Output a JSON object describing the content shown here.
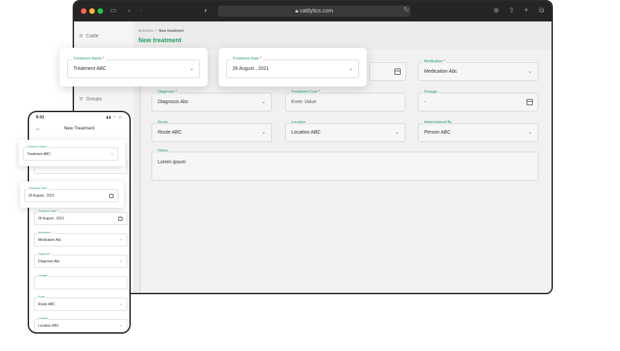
{
  "browser": {
    "url": "cattlytics.com",
    "sidebar": [
      {
        "label": "Cattle",
        "icon": "cattle-icon"
      },
      {
        "label": "Groups",
        "icon": "groups-icon"
      }
    ],
    "breadcrumb": {
      "parent": "Activities",
      "separator": "/",
      "current": "New treatment"
    },
    "title": "New treatment",
    "fields": {
      "medication": {
        "label": "Medication",
        "required": "*",
        "value": "Medication Abc"
      },
      "diagnosis": {
        "label": "Diagnosis",
        "required": "*",
        "value": "Diagnosis Abc"
      },
      "cost": {
        "label": "Treatment Cost",
        "required": "*",
        "value": "Enter Value"
      },
      "dosage": {
        "label": "Dosage",
        "value": "-"
      },
      "route": {
        "label": "Route",
        "value": "Route ABC"
      },
      "location": {
        "label": "Location",
        "value": "Location ABC"
      },
      "administered": {
        "label": "Administered By",
        "value": "Person ABC"
      },
      "notes": {
        "label": "Notes",
        "value": "Lorem ipsum"
      }
    }
  },
  "floating": {
    "treatment_name": {
      "label": "Treatment Name",
      "required": "*",
      "value": "Treatment ABC"
    },
    "treatment_date": {
      "label": "Treatment Date",
      "required": "*",
      "value": "26 August , 2021"
    }
  },
  "phone": {
    "time": "9:41",
    "title": "New Treatment",
    "card_name": {
      "label": "Treatment Name",
      "required": "*",
      "value": "Treatment ABC"
    },
    "card_date": {
      "label": "Treatment Date",
      "required": "*",
      "value": "26 August , 2021"
    },
    "date": {
      "label": "Treatment Date",
      "required": "*",
      "value": "26 August , 2021"
    },
    "medication": {
      "label": "Medication",
      "required": "*",
      "value": "Medication Abc"
    },
    "diagnosis": {
      "label": "Diagnosis",
      "required": "*",
      "value": "Diagnosis Abc"
    },
    "dosage": {
      "label": "Dosage",
      "value": ""
    },
    "route": {
      "label": "Route",
      "value": "Route ABC"
    },
    "location": {
      "label": "Location",
      "value": "Location ABC"
    }
  },
  "colors": {
    "accent": "#1f9c61",
    "required": "#d93030",
    "chrome": "#252527"
  }
}
